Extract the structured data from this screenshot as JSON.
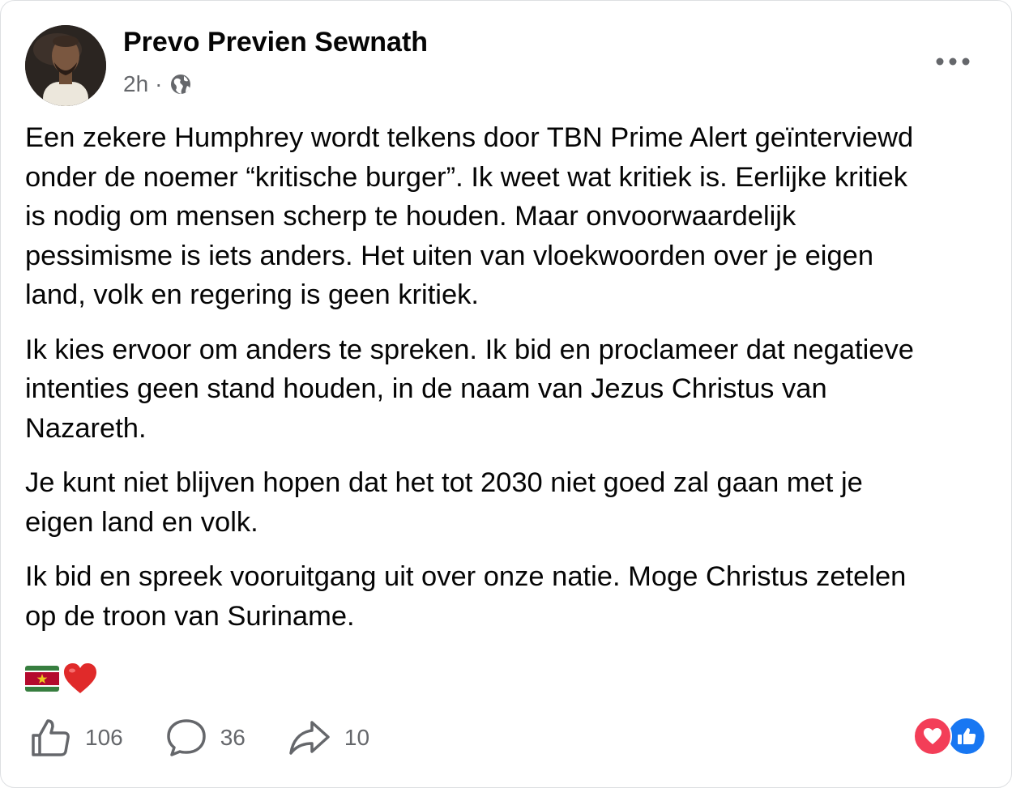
{
  "post": {
    "author": "Prevo Previen Sewnath",
    "time": "2h",
    "separator": "·",
    "privacy_icon": "globe-icon",
    "menu_icon": "more-horizontal-icon",
    "paragraphs": [
      "Een zekere Humphrey wordt telkens door TBN Prime Alert geïnterviewd\nonder de noemer “kritische burger”. Ik weet wat kritiek is. Eerlijke kritiek\nis nodig om mensen scherp te houden. Maar onvoorwaardelijk\npessimisme is iets anders. Het uiten van vloekwoorden over je eigen\nland, volk en regering is geen kritiek.",
      "Ik kies ervoor om anders te spreken. Ik bid en proclameer dat negatieve\nintenties geen stand houden, in de naam van Jezus Christus van\nNazareth.",
      "Je kunt niet blijven hopen dat het tot 2030 niet goed zal gaan met je\neigen land en volk.",
      "Ik bid en spreek vooruitgang uit over onze natie. Moge Christus zetelen\nop de troon van Suriname."
    ],
    "emojis": [
      "suriname-flag-icon",
      "red-heart-icon"
    ]
  },
  "actions": {
    "like": {
      "icon": "thumbs-up-icon",
      "count": "106"
    },
    "comment": {
      "icon": "comment-icon",
      "count": "36"
    },
    "share": {
      "icon": "share-arrow-icon",
      "count": "10"
    }
  },
  "reactions": [
    "love-reaction-icon",
    "like-reaction-icon"
  ],
  "colors": {
    "text": "#050505",
    "secondary": "#65676b",
    "like_blue": "#1877f2",
    "love_red": "#f33e58"
  }
}
